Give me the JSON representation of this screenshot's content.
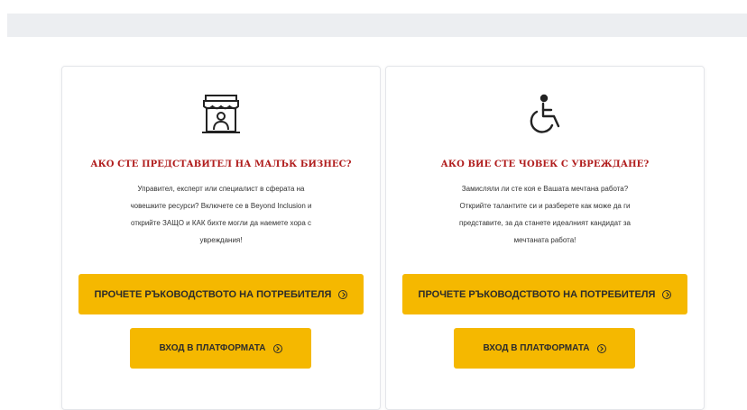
{
  "colors": {
    "accent": "#f5b800",
    "title": "#b01d1d",
    "top_bar": "#eceef1"
  },
  "cards": [
    {
      "icon": "shop-icon",
      "title": "АКО СТЕ ПРЕДСТАВИТЕЛ НА МАЛЪК БИЗНЕС?",
      "text": "Управител, експерт или специалист в сферата на\nчовешките ресурси? Включете се в Beyond Inclusion и\nоткрийте ЗАЩО и КАК бихте могли да наемете хора с\nувреждания!",
      "guide_button": "ПРОЧЕТЕ РЪКОВОДСТВОТО НА ПОТРЕБИТЕЛЯ",
      "login_button": "ВХОД В ПЛАТФОРМАТА"
    },
    {
      "icon": "wheelchair-icon",
      "title": "АКО ВИЕ СТЕ ЧОВЕК С УВРЕЖДАНЕ?",
      "text": "Замисляли ли сте коя е Вашата мечтана работа?\nОткрийте талантите си и разберете как може да ги\nпредставите, за да станете идеалният кандидат за\nмечтаната работа!",
      "guide_button": "ПРОЧЕТЕ РЪКОВОДСТВОТО НА ПОТРЕБИТЕЛЯ",
      "login_button": "ВХОД В ПЛАТФОРМАТА"
    }
  ]
}
